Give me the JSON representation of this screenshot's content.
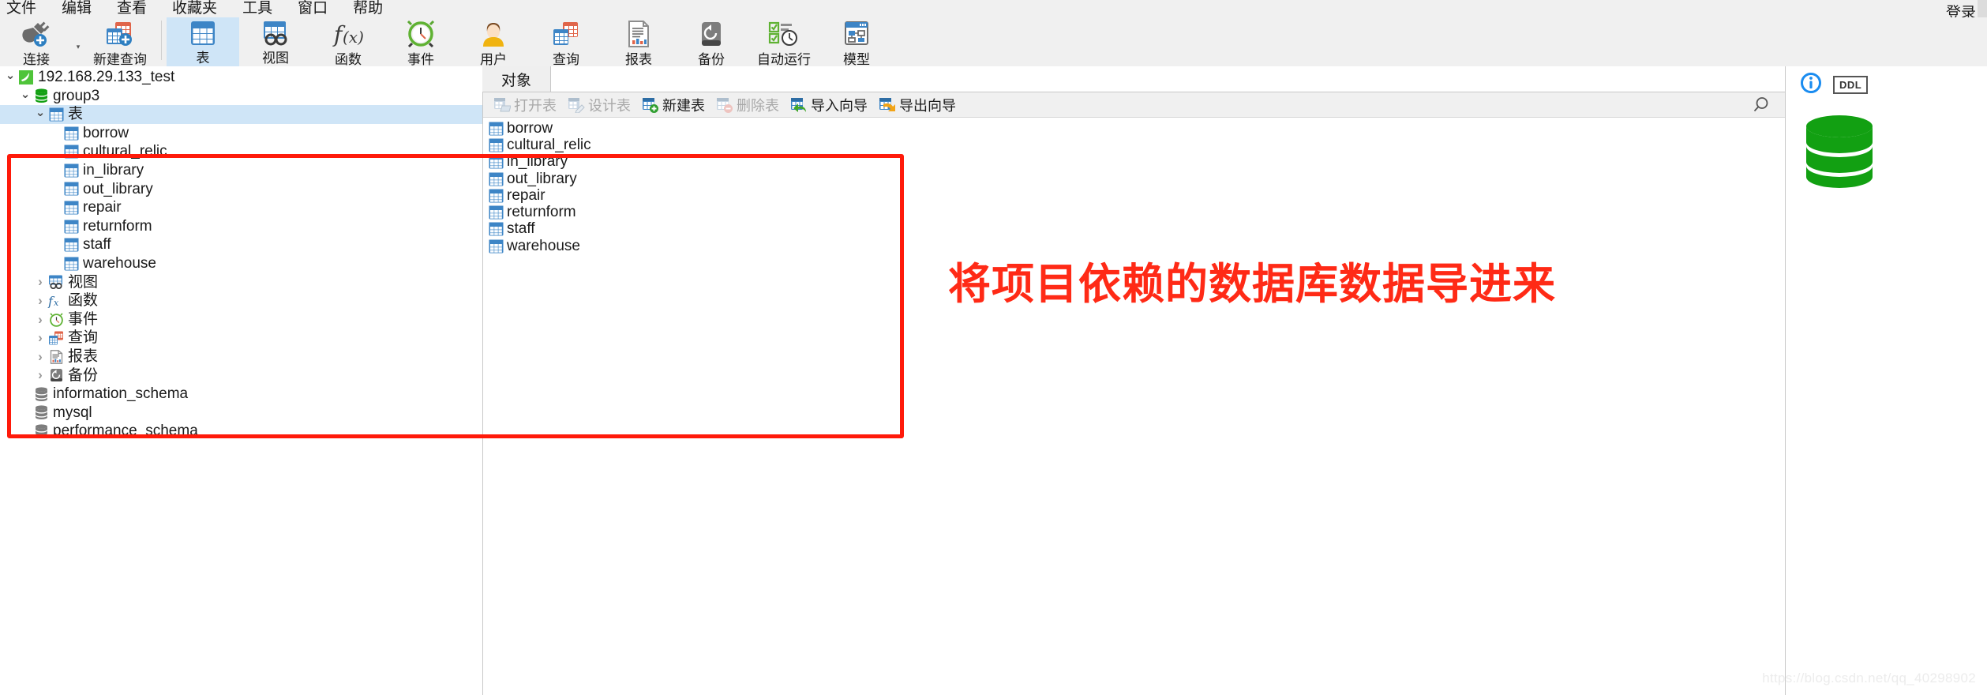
{
  "menubar": {
    "items": [
      {
        "label": "文件",
        "name": "menu-file"
      },
      {
        "label": "编辑",
        "name": "menu-edit"
      },
      {
        "label": "查看",
        "name": "menu-view"
      },
      {
        "label": "收藏夹",
        "name": "menu-favorites"
      },
      {
        "label": "工具",
        "name": "menu-tools"
      },
      {
        "label": "窗口",
        "name": "menu-window"
      },
      {
        "label": "帮助",
        "name": "menu-help"
      }
    ],
    "login_label": "登录"
  },
  "toolbar": {
    "items": [
      {
        "label": "连接",
        "icon": "connection-plug-icon",
        "selected": false,
        "caret": true
      },
      {
        "label": "新建查询",
        "icon": "new-query-icon",
        "selected": false,
        "caret": false
      },
      {
        "label": "表",
        "icon": "table-icon",
        "selected": true,
        "caret": false
      },
      {
        "label": "视图",
        "icon": "view-icon",
        "selected": false,
        "caret": false
      },
      {
        "label": "函数",
        "icon": "function-fx-icon",
        "selected": false,
        "caret": false
      },
      {
        "label": "事件",
        "icon": "event-clock-icon",
        "selected": false,
        "caret": false
      },
      {
        "label": "用户",
        "icon": "user-icon",
        "selected": false,
        "caret": false
      },
      {
        "label": "查询",
        "icon": "query-icon",
        "selected": false,
        "caret": false
      },
      {
        "label": "报表",
        "icon": "report-icon",
        "selected": false,
        "caret": false
      },
      {
        "label": "备份",
        "icon": "backup-icon",
        "selected": false,
        "caret": false
      },
      {
        "label": "自动运行",
        "icon": "automation-icon",
        "selected": false,
        "caret": false
      },
      {
        "label": "模型",
        "icon": "model-icon",
        "selected": false,
        "caret": false
      }
    ]
  },
  "sidebar": {
    "nodes": [
      {
        "label": "192.168.29.133_test",
        "icon": "mysql-connection-icon",
        "indent": 0,
        "state": "expanded",
        "selected": false
      },
      {
        "label": "group3",
        "icon": "database-green-icon",
        "indent": 1,
        "state": "expanded",
        "selected": false
      },
      {
        "label": "表",
        "icon": "table-icon",
        "indent": 2,
        "state": "expanded",
        "selected": true
      },
      {
        "label": "borrow",
        "icon": "table-icon",
        "indent": 3,
        "state": "leaf",
        "selected": false
      },
      {
        "label": "cultural_relic",
        "icon": "table-icon",
        "indent": 3,
        "state": "leaf",
        "selected": false
      },
      {
        "label": "in_library",
        "icon": "table-icon",
        "indent": 3,
        "state": "leaf",
        "selected": false
      },
      {
        "label": "out_library",
        "icon": "table-icon",
        "indent": 3,
        "state": "leaf",
        "selected": false
      },
      {
        "label": "repair",
        "icon": "table-icon",
        "indent": 3,
        "state": "leaf",
        "selected": false
      },
      {
        "label": "returnform",
        "icon": "table-icon",
        "indent": 3,
        "state": "leaf",
        "selected": false
      },
      {
        "label": "staff",
        "icon": "table-icon",
        "indent": 3,
        "state": "leaf",
        "selected": false
      },
      {
        "label": "warehouse",
        "icon": "table-icon",
        "indent": 3,
        "state": "leaf",
        "selected": false
      },
      {
        "label": "视图",
        "icon": "view-icon",
        "indent": 2,
        "state": "collapsed",
        "selected": false
      },
      {
        "label": "函数",
        "icon": "function-fx-icon",
        "indent": 2,
        "state": "collapsed",
        "selected": false
      },
      {
        "label": "事件",
        "icon": "event-clock-icon",
        "indent": 2,
        "state": "collapsed",
        "selected": false
      },
      {
        "label": "查询",
        "icon": "query-icon",
        "indent": 2,
        "state": "collapsed",
        "selected": false
      },
      {
        "label": "报表",
        "icon": "report-icon",
        "indent": 2,
        "state": "collapsed",
        "selected": false
      },
      {
        "label": "备份",
        "icon": "backup-icon",
        "indent": 2,
        "state": "collapsed",
        "selected": false
      },
      {
        "label": "information_schema",
        "icon": "database-gray-icon",
        "indent": 1,
        "state": "leaf",
        "selected": false
      },
      {
        "label": "mysql",
        "icon": "database-gray-icon",
        "indent": 1,
        "state": "leaf",
        "selected": false
      },
      {
        "label": "performance_schema",
        "icon": "database-gray-icon",
        "indent": 1,
        "state": "leaf",
        "selected": false
      }
    ]
  },
  "object_pane": {
    "tab_label": "对象",
    "buttons": [
      {
        "label": "打开表",
        "icon": "open-table-icon",
        "disabled": true
      },
      {
        "label": "设计表",
        "icon": "design-table-icon",
        "disabled": true
      },
      {
        "label": "新建表",
        "icon": "new-table-icon",
        "disabled": false
      },
      {
        "label": "删除表",
        "icon": "delete-table-icon",
        "disabled": true
      },
      {
        "label": "导入向导",
        "icon": "import-wizard-icon",
        "disabled": false
      },
      {
        "label": "导出向导",
        "icon": "export-wizard-icon",
        "disabled": false
      }
    ],
    "search_icon": "search-icon",
    "tables": [
      "borrow",
      "cultural_relic",
      "in_library",
      "out_library",
      "repair",
      "returnform",
      "staff",
      "warehouse"
    ]
  },
  "info_pane": {
    "info_icon": "info-circle-icon",
    "ddl_tab_label": "DDL",
    "database_icon": "database-green-icon"
  },
  "annotation": {
    "text": "将项目依赖的数据库数据导进来",
    "color": "#ff2a16",
    "box_color": "#ff1a0a"
  },
  "watermark": {
    "text": "https://blog.csdn.net/qq_40298902"
  },
  "colors": {
    "selection": "#cfe5f7",
    "chrome": "#f0f0f0",
    "table_blue": "#3d85c6",
    "db_green": "#12a012",
    "db_gray": "#808080"
  }
}
